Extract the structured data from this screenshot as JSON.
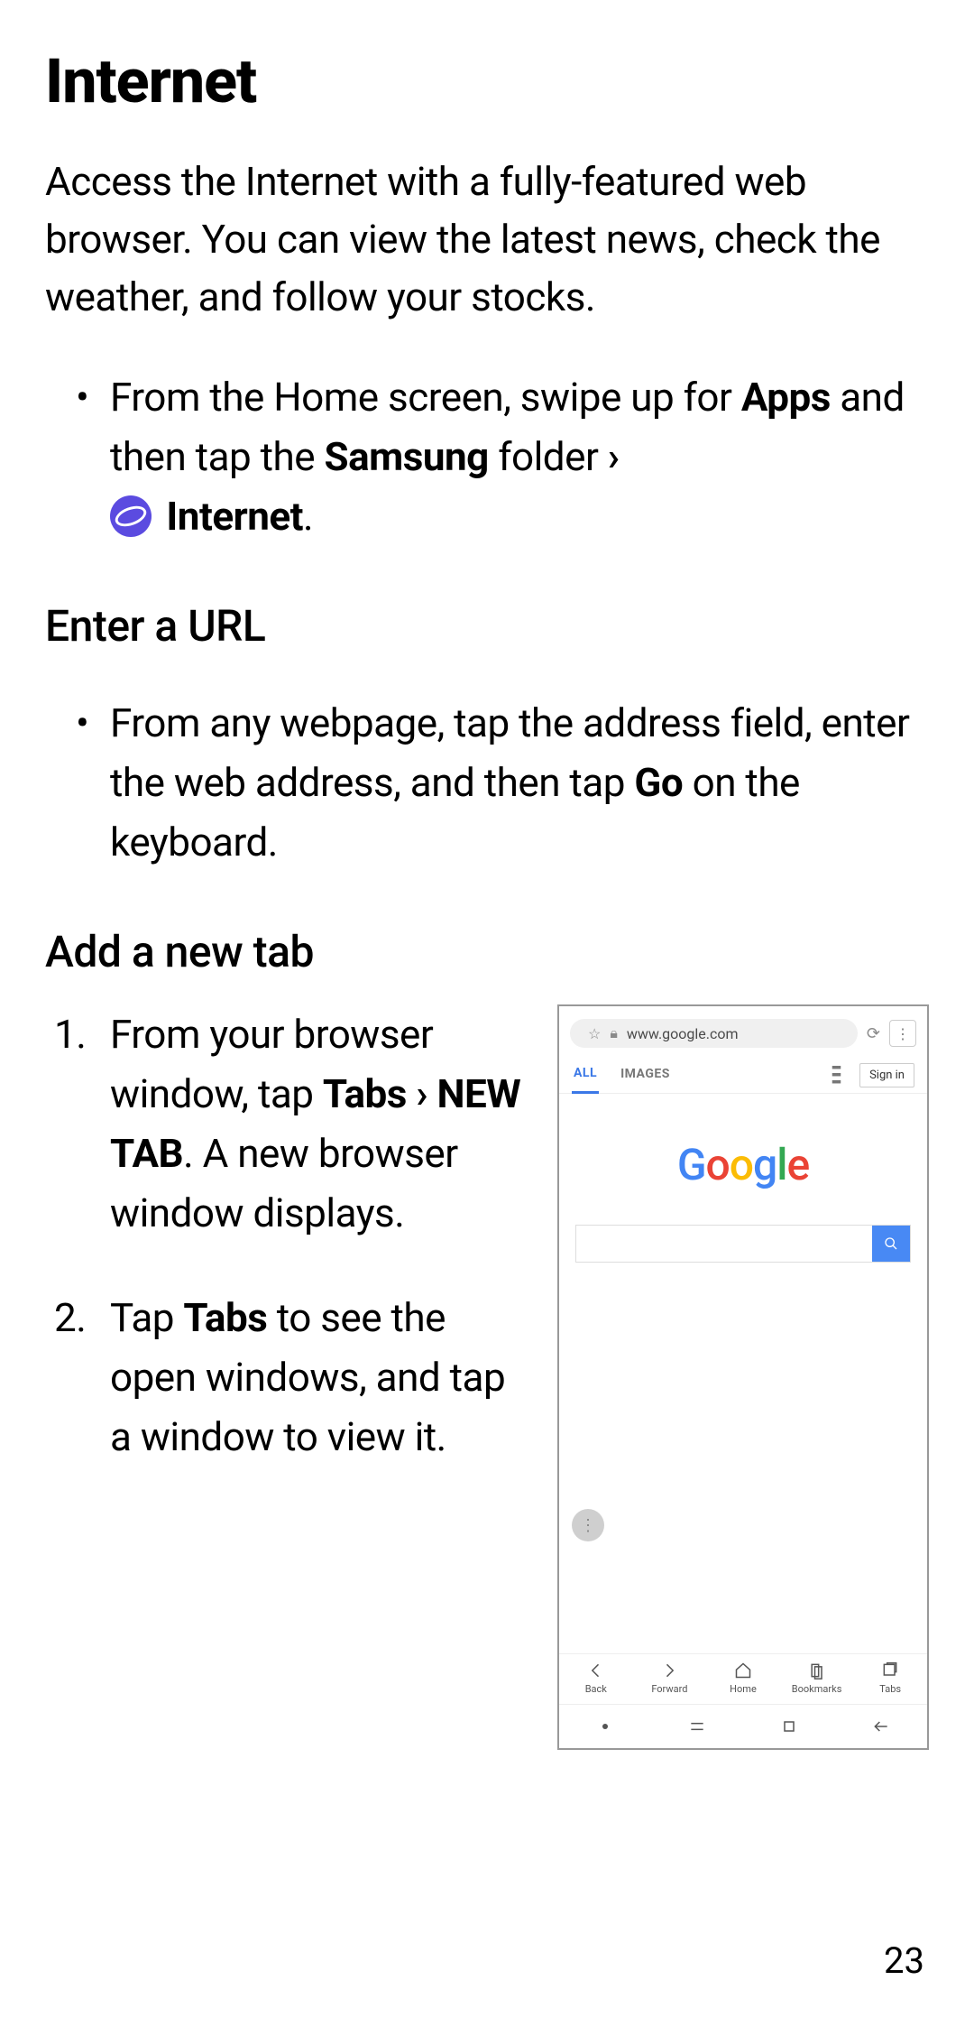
{
  "title": "Internet",
  "intro": "Access the Internet with a fully-featured web browser. You can view the latest news, check the weather, and follow your stocks.",
  "bullet1": {
    "part1": "From the Home screen, swipe up for ",
    "apps": "Apps",
    "part2": " and then tap the ",
    "samsung": "Samsung",
    "part3": " folder ",
    "chev": "›",
    "internet_label": " Internet",
    "period": "."
  },
  "sub1": "Enter a URL",
  "bullet2": {
    "part1": "From any webpage, tap the address field, enter the web address, and then tap ",
    "go": "Go",
    "part2": " on the keyboard."
  },
  "sub2": "Add a new tab",
  "step1": {
    "p1": "From your browser window, tap ",
    "tabs": "Tabs",
    "chev": " › ",
    "newtab": "NEW TAB",
    "p2": ". A new browser window displays."
  },
  "step2": {
    "p1": "Tap ",
    "tabs": "Tabs",
    "p2": " to see the open windows, and tap a window to view it."
  },
  "phone": {
    "url": "www.google.com",
    "tabs": {
      "all": "ALL",
      "images": "IMAGES"
    },
    "signin": "Sign in",
    "bottom": {
      "back": "Back",
      "forward": "Forward",
      "home": "Home",
      "bookmarks": "Bookmarks",
      "tabs": "Tabs"
    }
  },
  "page_number": "23"
}
